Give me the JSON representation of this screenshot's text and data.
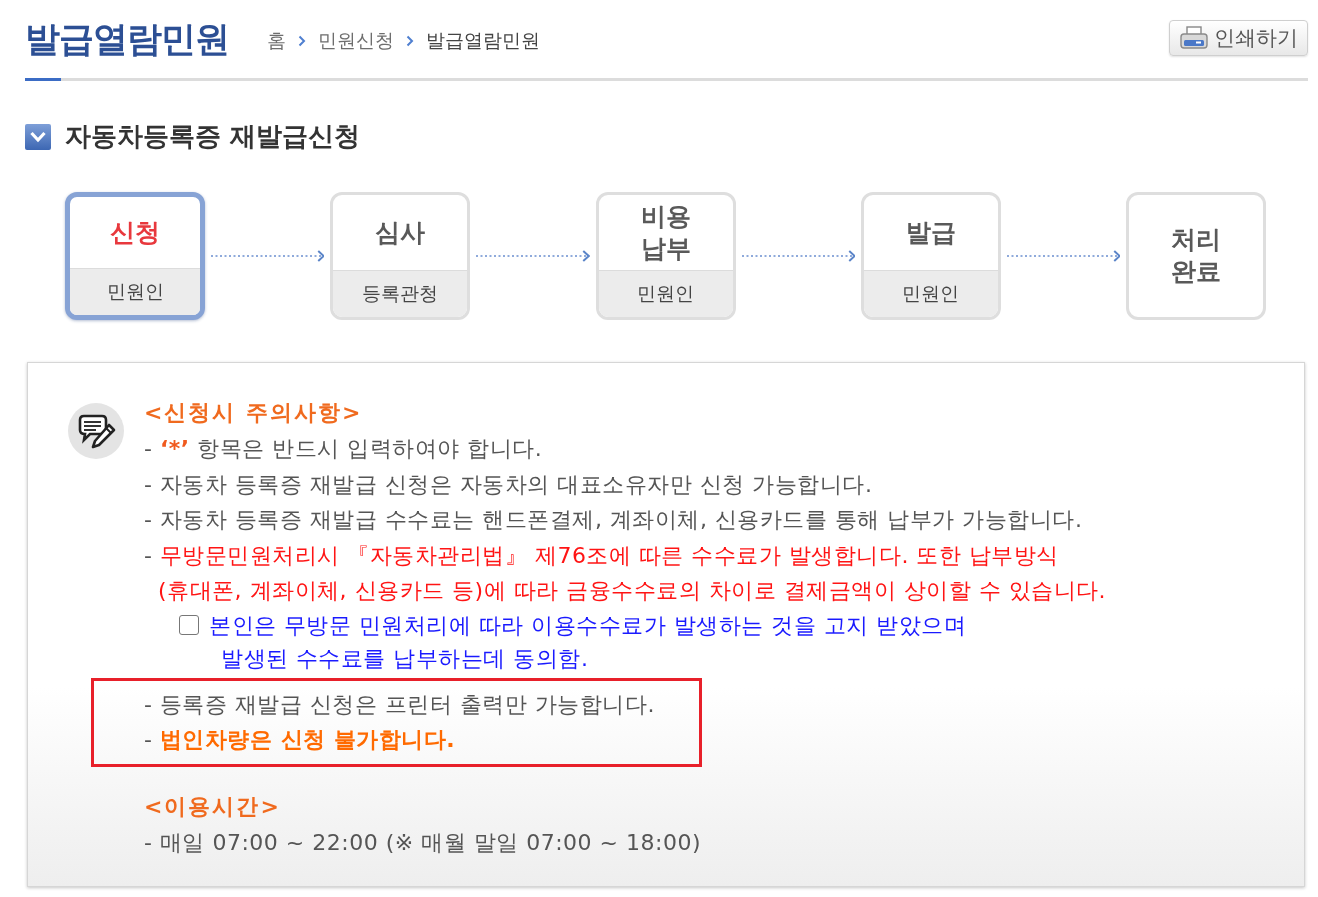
{
  "header": {
    "title": "발급열람민원",
    "breadcrumb": [
      "홈",
      "민원신청",
      "발급열람민원"
    ],
    "print_button": "인쇄하기"
  },
  "section_title": "자동차등록증 재발급신청",
  "steps": [
    {
      "title": [
        "신청"
      ],
      "actor": "민원인",
      "selected": true
    },
    {
      "title": [
        "심사"
      ],
      "actor": "등록관청",
      "selected": false
    },
    {
      "title": [
        "비용",
        "납부"
      ],
      "actor": "민원인",
      "selected": false
    },
    {
      "title": [
        "발급"
      ],
      "actor": "민원인",
      "selected": false
    },
    {
      "title": [
        "처리",
        "완료"
      ],
      "selected": false
    }
  ],
  "notice": {
    "title": "<신청시 주의사항>",
    "items": [
      {
        "kind": "note",
        "bullet": "-",
        "mark": "‘*’",
        "text": "항목은 반드시 입력하여야 합니다."
      },
      {
        "kind": "note",
        "bullet": "-",
        "text": "자동차 등록증 재발급 신청은 자동차의 대표소유자만 신청 가능합니다."
      },
      {
        "kind": "note",
        "bullet": "-",
        "text": "자동차 등록증 재발급 수수료는 핸드폰결제, 계좌이체, 신용카드를 통해 납부가 가능합니다."
      },
      {
        "kind": "warning",
        "bullet": "-",
        "lines": [
          "무방문민원처리시 『자동차관리법』 제76조에 따른 수수료가 발생합니다. 또한 납부방식",
          "(휴대폰, 계좌이체, 신용카드 등)에 따라 금융수수료의 차이로 결제금액이 상이할 수 있습니다."
        ]
      },
      {
        "kind": "consent",
        "checked": false,
        "lines": [
          "본인은 무방문 민원처리에 따라 이용수수료가 발생하는 것을 고지 받았으며",
          "발생된 수수료를 납부하는데 동의함."
        ]
      }
    ],
    "highlighted_items": [
      {
        "kind": "note",
        "bullet": "-",
        "text": "등록증 재발급 신청은 프린터 출력만 가능합니다."
      },
      {
        "kind": "emphasis",
        "bullet": "-",
        "text": "법인차량은 신청 불가합니다."
      }
    ]
  },
  "usage": {
    "title": "<이용시간>",
    "items": [
      {
        "kind": "note",
        "bullet": "-",
        "text": "매일 07:00 ~ 22:00 (※ 매월 말일 07:00 ~ 18:00)"
      }
    ]
  }
}
